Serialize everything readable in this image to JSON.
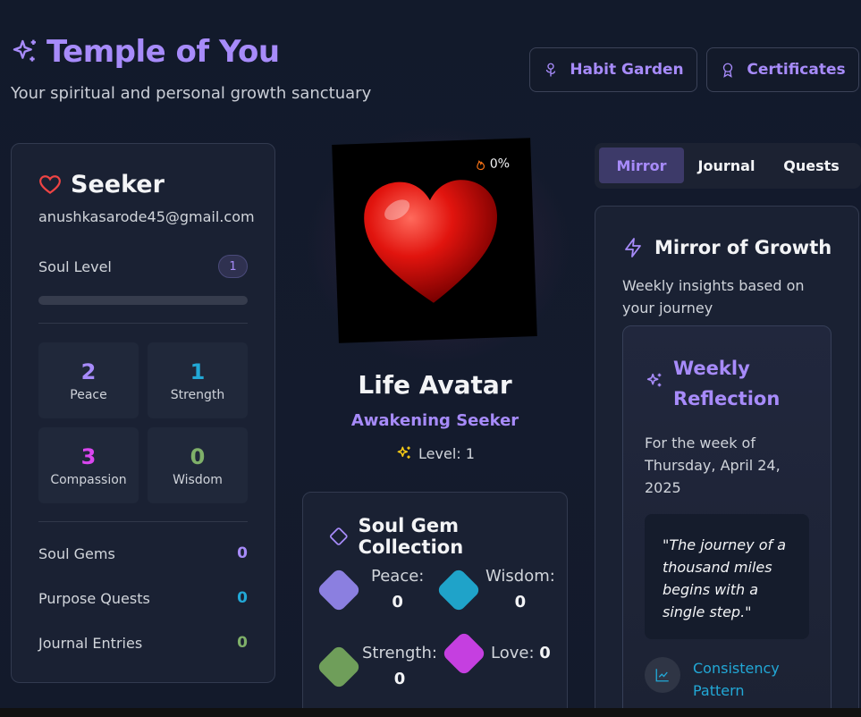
{
  "header": {
    "title": "Temple of You",
    "subtitle": "Your spiritual and personal growth sanctuary",
    "buttons": {
      "habit_garden": "Habit Garden",
      "certificates": "Certificates"
    },
    "accent": "#a78bfa"
  },
  "profile": {
    "name": "Seeker",
    "email": "anushkasarode45@gmail.com",
    "soul_level_label": "Soul Level",
    "soul_level": "1",
    "progress": 0,
    "stats": [
      {
        "value": "2",
        "label": "Peace",
        "color": "#a78bfa"
      },
      {
        "value": "1",
        "label": "Strength",
        "color": "#22a8d6"
      },
      {
        "value": "3",
        "label": "Compassion",
        "color": "#d946ef"
      },
      {
        "value": "0",
        "label": "Wisdom",
        "color": "#7fb069"
      }
    ],
    "counts": [
      {
        "label": "Soul Gems",
        "value": "0",
        "color": "#a78bfa"
      },
      {
        "label": "Purpose Quests",
        "value": "0",
        "color": "#22a8d6"
      },
      {
        "label": "Journal Entries",
        "value": "0",
        "color": "#7fb069"
      }
    ]
  },
  "avatar": {
    "percent": "0%",
    "title": "Life Avatar",
    "subtitle": "Awakening Seeker",
    "level_text": "Level: 1"
  },
  "gems": {
    "title": "Soul Gem Collection",
    "items": [
      {
        "label": "Peace:",
        "value": "0",
        "color": "#8b7fe0"
      },
      {
        "label": "Wisdom:",
        "value": "0",
        "color": "#1fa3c9"
      },
      {
        "label": "Strength:",
        "value": "0",
        "color": "#6f9e5a"
      },
      {
        "label": "Love:",
        "value": "0",
        "color": "#c53fe0"
      }
    ]
  },
  "tabs": {
    "mirror": "Mirror",
    "journal": "Journal",
    "quests": "Quests",
    "active": "Mirror"
  },
  "mirror": {
    "title": "Mirror of Growth",
    "description": "Weekly insights based on your journey",
    "reflection_title": "Weekly Reflection",
    "week_text": "For the week of Thursday, April 24, 2025",
    "quote": "\"The journey of a thousand miles begins with a single step.\"",
    "consistency": "Consistency Pattern"
  }
}
